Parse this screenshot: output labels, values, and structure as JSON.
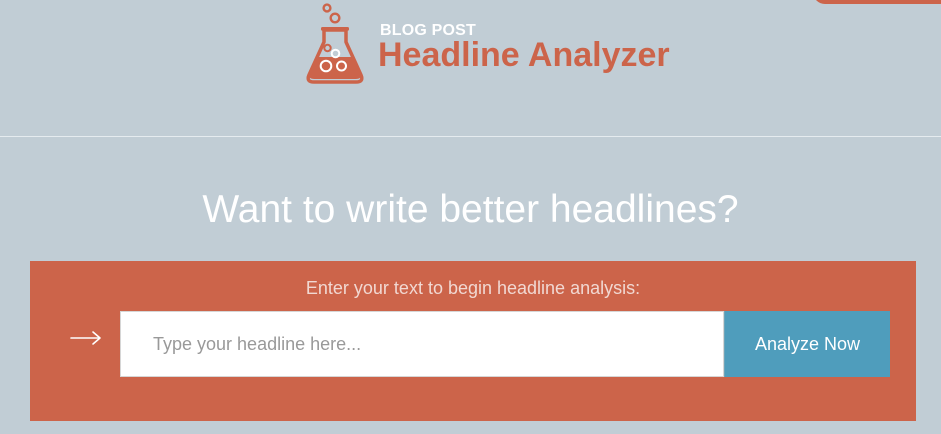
{
  "header": {
    "logo_kicker": "BLOG POST",
    "logo_title": "Headline Analyzer",
    "logo_icon": "flask-icon"
  },
  "hero": {
    "heading": "Want to write better headlines?"
  },
  "analyzer": {
    "prompt": "Enter your text to begin headline analysis:",
    "arrow_icon": "arrow-right-icon",
    "input_placeholder": "Type your headline here...",
    "input_value": "",
    "button_label": "Analyze Now"
  },
  "colors": {
    "background": "#c1cdd5",
    "brand": "#cc644a",
    "button": "#4f9dbc",
    "white": "#ffffff"
  }
}
